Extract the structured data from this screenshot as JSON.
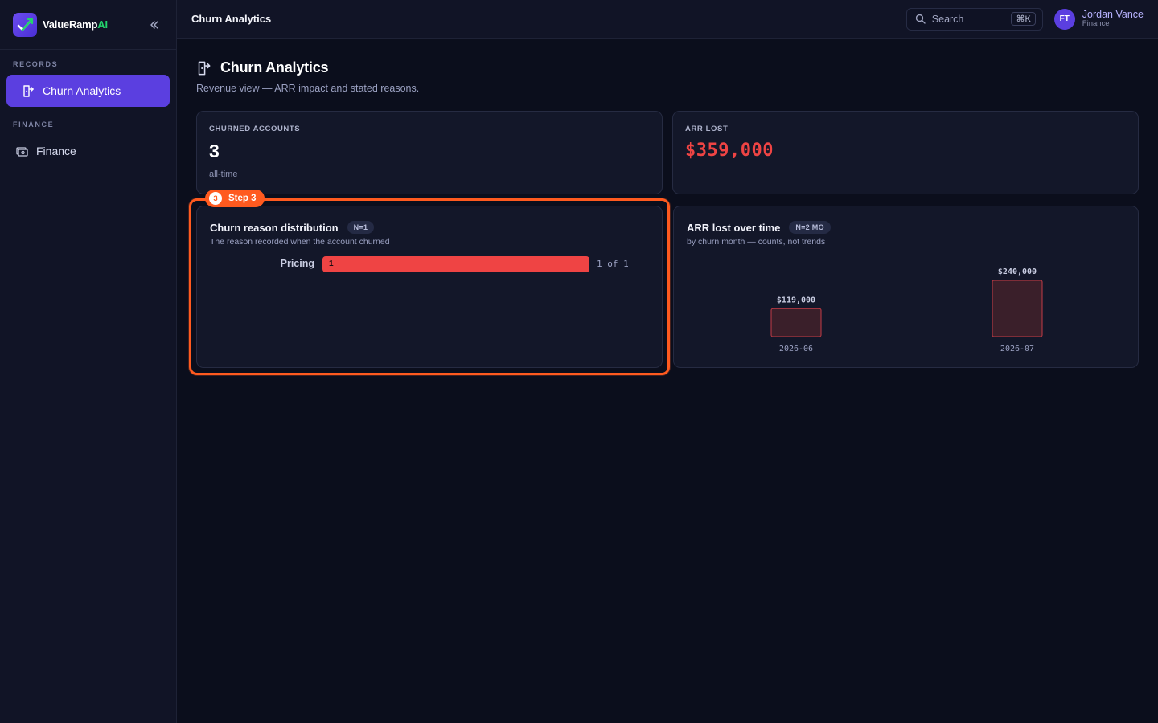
{
  "brand": {
    "name": "ValueRamp",
    "suffix": "AI"
  },
  "sidebar": {
    "records_label": "RECORDS",
    "finance_label": "FINANCE",
    "items": [
      {
        "label": "Churn Analytics",
        "icon": "churn-icon",
        "active": true
      },
      {
        "label": "Finance",
        "icon": "finance-icon",
        "active": false
      }
    ]
  },
  "topbar": {
    "title": "Churn Analytics",
    "search_placeholder": "Search",
    "shortcut": "⌘K",
    "user": {
      "initials": "FT",
      "name": "Jordan Vance",
      "role": "Finance"
    }
  },
  "page": {
    "title": "Churn Analytics",
    "subtitle": "Revenue view — ARR impact and stated reasons."
  },
  "kpis": {
    "churned": {
      "label": "CHURNED ACCOUNTS",
      "value": "3",
      "foot": "all-time"
    },
    "arr_lost": {
      "label": "ARR LOST",
      "value": "$359,000"
    }
  },
  "reason_card": {
    "title": "Churn reason distribution",
    "pill": "N=1",
    "subtitle": "The reason recorded when the account churned"
  },
  "arr_card": {
    "title": "ARR lost over time",
    "pill": "N=2 MO",
    "subtitle": "by churn month — counts, not trends"
  },
  "step": {
    "number": "3",
    "label": "Step 3"
  },
  "colors": {
    "accent": "#5b3fe0",
    "danger": "#ef4444",
    "highlight": "#ff5a1f",
    "brand_green": "#22d36b"
  },
  "chart_data": [
    {
      "type": "bar",
      "orientation": "horizontal",
      "categories": [
        "Pricing"
      ],
      "values": [
        1
      ],
      "total": 1,
      "value_labels": [
        "1"
      ],
      "count_labels": [
        "1 of 1"
      ]
    },
    {
      "type": "bar",
      "categories": [
        "2026-06",
        "2026-07"
      ],
      "values": [
        119000,
        240000
      ],
      "value_labels": [
        "$119,000",
        "$240,000"
      ]
    }
  ]
}
